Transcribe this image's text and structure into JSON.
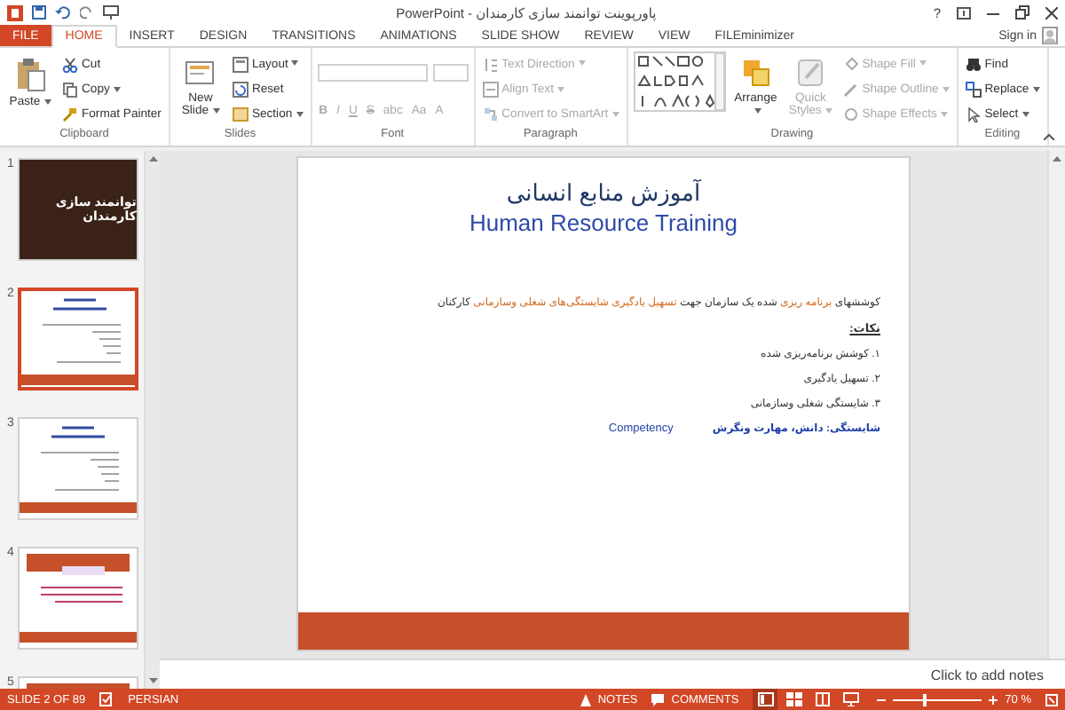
{
  "window": {
    "title": "پاورپوینت توانمند سازی کارمندان - PowerPoint",
    "help": "?"
  },
  "tabs": [
    {
      "label": "FILE",
      "kind": "file",
      "selected": false
    },
    {
      "label": "HOME",
      "kind": "tab",
      "selected": true
    },
    {
      "label": "INSERT",
      "kind": "tab",
      "selected": false
    },
    {
      "label": "DESIGN",
      "kind": "tab",
      "selected": false
    },
    {
      "label": "TRANSITIONS",
      "kind": "tab",
      "selected": false
    },
    {
      "label": "ANIMATIONS",
      "kind": "tab",
      "selected": false
    },
    {
      "label": "SLIDE SHOW",
      "kind": "tab",
      "selected": false
    },
    {
      "label": "REVIEW",
      "kind": "tab",
      "selected": false
    },
    {
      "label": "VIEW",
      "kind": "tab",
      "selected": false
    },
    {
      "label": "FILEminimizer",
      "kind": "tab",
      "selected": false
    }
  ],
  "sign_in": "Sign in",
  "ribbon": {
    "groups": [
      {
        "label": "Clipboard",
        "big": [
          {
            "kind": "paste",
            "label": "Paste",
            "dropdown": true,
            "disabled": false
          }
        ],
        "small": [
          {
            "kind": "cut",
            "label": "Cut",
            "dropdown": false,
            "disabled": false
          },
          {
            "kind": "copy",
            "label": "Copy",
            "dropdown": true,
            "disabled": false
          },
          {
            "kind": "painter",
            "label": "Format Painter",
            "dropdown": false,
            "disabled": false
          }
        ]
      },
      {
        "label": "Slides",
        "big": [
          {
            "kind": "newslide",
            "label": "New Slide",
            "dropdown": true,
            "disabled": false
          }
        ],
        "small": [
          {
            "kind": "layout",
            "label": "Layout",
            "dropdown": true,
            "disabled": false
          },
          {
            "kind": "reset",
            "label": "Reset",
            "dropdown": false,
            "disabled": false
          },
          {
            "kind": "section",
            "label": "Section",
            "dropdown": true,
            "disabled": false
          }
        ]
      },
      {
        "label": "Font",
        "kind": "font",
        "format_buttons": [
          {
            "label": "B",
            "disabled": true
          },
          {
            "label": "I",
            "disabled": true
          },
          {
            "label": "U",
            "disabled": true
          },
          {
            "label": "S",
            "disabled": true
          },
          {
            "label": "abc",
            "disabled": true
          },
          {
            "label": "Aa",
            "disabled": true
          },
          {
            "label": "A",
            "disabled": true
          }
        ]
      },
      {
        "label": "Paragraph",
        "small": [
          {
            "kind": "textdir",
            "label": "Text Direction",
            "dropdown": true,
            "disabled": true
          },
          {
            "kind": "align",
            "label": "Align Text",
            "dropdown": true,
            "disabled": true
          },
          {
            "kind": "smartart",
            "label": "Convert to SmartArt",
            "dropdown": true,
            "disabled": true
          }
        ]
      },
      {
        "label": "Drawing",
        "kind": "drawing",
        "big": [
          {
            "kind": "arrange",
            "label": "Arrange",
            "dropdown": true,
            "disabled": false
          },
          {
            "kind": "quickstyles",
            "label": "Quick Styles",
            "dropdown": true,
            "disabled": true
          }
        ],
        "small": [
          {
            "kind": "fill",
            "label": "Shape Fill",
            "dropdown": true,
            "disabled": true
          },
          {
            "kind": "outline",
            "label": "Shape Outline",
            "dropdown": true,
            "disabled": true
          },
          {
            "kind": "effects",
            "label": "Shape Effects",
            "dropdown": true,
            "disabled": true
          }
        ]
      },
      {
        "label": "Editing",
        "small": [
          {
            "kind": "find",
            "label": "Find",
            "dropdown": false,
            "disabled": false
          },
          {
            "kind": "replace",
            "label": "Replace",
            "dropdown": true,
            "disabled": false
          },
          {
            "kind": "select",
            "label": "Select",
            "dropdown": true,
            "disabled": false
          }
        ]
      }
    ]
  },
  "thumbnails": [
    {
      "number": "1",
      "kind": "photo",
      "title": "توانمند سازی کارمندان",
      "selected": false
    },
    {
      "number": "2",
      "kind": "text",
      "selected": true
    },
    {
      "number": "3",
      "kind": "text",
      "selected": false
    },
    {
      "number": "4",
      "kind": "banner",
      "selected": false
    },
    {
      "number": "5",
      "kind": "banner",
      "selected": false
    }
  ],
  "slide": {
    "title": "آموزش منابع انسانی",
    "subtitle": "Human Resource Training",
    "paragraph": [
      {
        "text": "کوششهای ",
        "highlight": false
      },
      {
        "text": "برنامه ریزی",
        "highlight": true
      },
      {
        "text": " شده یک سازمان جهت ",
        "highlight": false
      },
      {
        "text": "تسهیل یادگیری شایستگی‌های شغلی وسازمانی",
        "highlight": true
      },
      {
        "text": " کارکنان",
        "highlight": false
      }
    ],
    "notes_heading": "نکات:",
    "points": [
      "۱. کوشش برنامه‌ریزی شده",
      "۲. تسهیل یادگیری",
      "۳. شایستگی شغلی وسازمانی"
    ],
    "definition": "شایستگی: دانش، مهارت ونگرش",
    "term": "Competency"
  },
  "notes_placeholder": "Click to add notes",
  "status_bar": {
    "slide": "SLIDE 2 OF 89",
    "language": "PERSIAN",
    "notes": "NOTES",
    "comments": "COMMENTS",
    "views": [
      {
        "kind": "normal",
        "selected": true
      },
      {
        "kind": "sorter",
        "selected": false
      },
      {
        "kind": "reading",
        "selected": false
      },
      {
        "kind": "show",
        "selected": false
      }
    ],
    "zoom": {
      "level": 0.35,
      "reading": "70 %"
    }
  }
}
